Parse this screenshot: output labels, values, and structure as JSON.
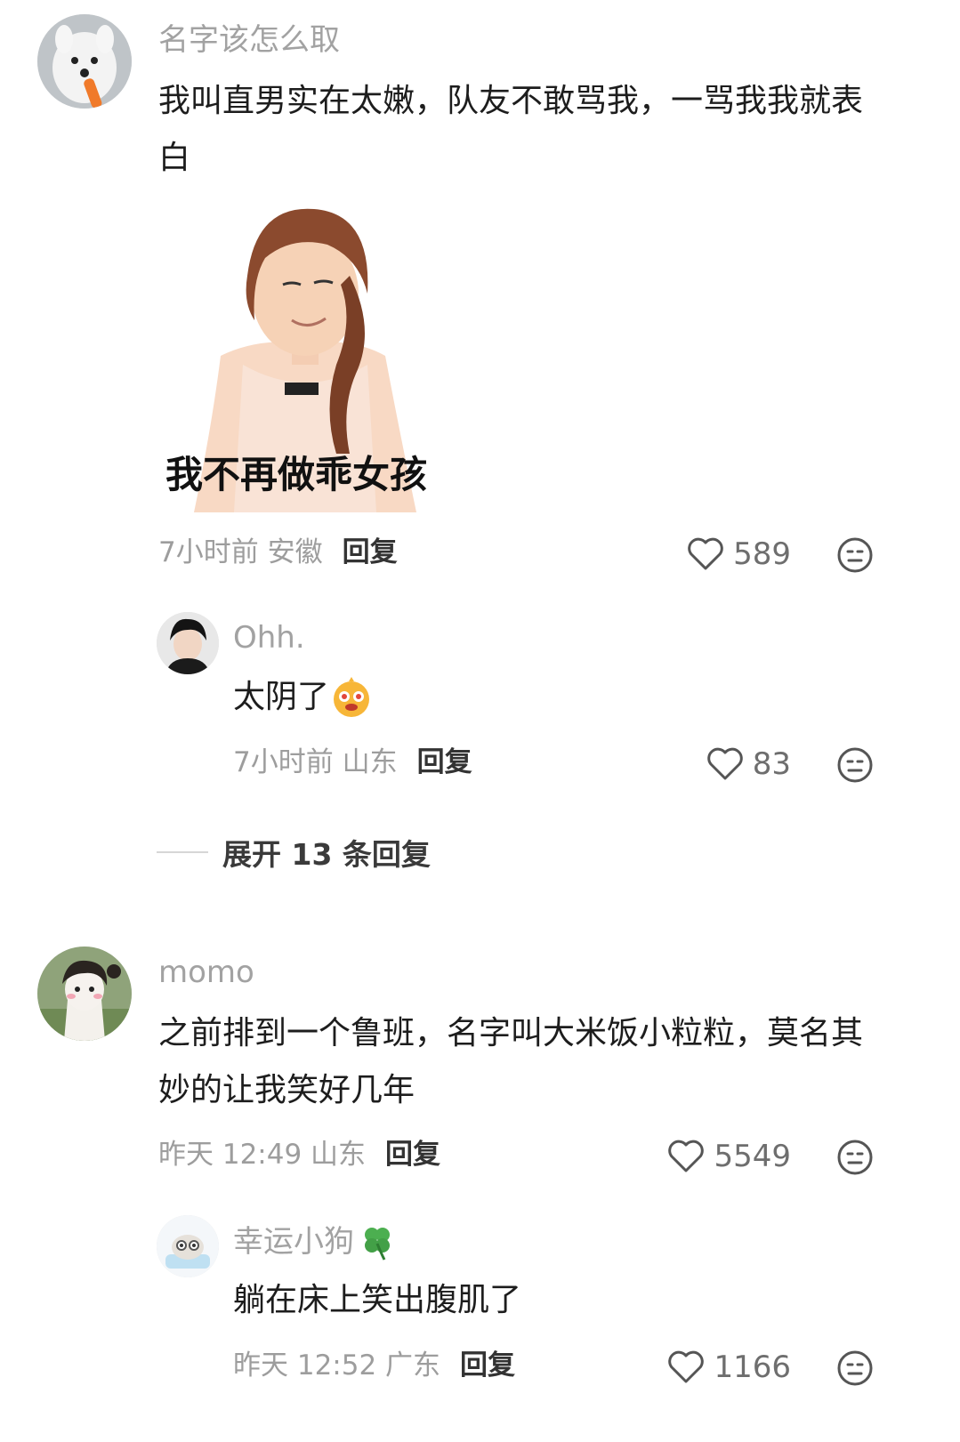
{
  "comments": [
    {
      "username": "名字该怎么取",
      "text": "我叫直男实在太嫩，队友不敢骂我，一骂我我就表白",
      "meme_caption": "我不再做乖女孩",
      "time": "7小时前 安徽",
      "reply_label": "回复",
      "likes": "589",
      "replies": [
        {
          "username": "Ohh.",
          "text": "太阴了",
          "time": "7小时前 山东",
          "reply_label": "回复",
          "likes": "83"
        }
      ],
      "expand_label": "展开 13 条回复"
    },
    {
      "username": "momo",
      "text": "之前排到一个鲁班，名字叫大米饭小粒粒，莫名其妙的让我笑好几年",
      "time": "昨天 12:49 山东",
      "reply_label": "回复",
      "likes": "5549",
      "replies": [
        {
          "username": "幸运小狗",
          "text": "躺在床上笑出腹肌了",
          "time": "昨天 12:52 广东",
          "reply_label": "回复",
          "likes": "1166"
        }
      ]
    }
  ],
  "icons": {
    "like": "heart-outline-icon",
    "dislike": "meh-face-icon",
    "emoji": "starry-eyed-emoji-icon",
    "clover": "four-leaf-clover-icon"
  }
}
